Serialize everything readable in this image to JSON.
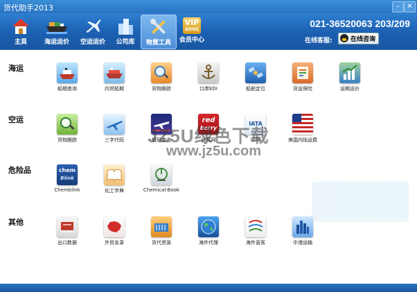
{
  "window": {
    "title": "货代助手2013"
  },
  "window_buttons": {
    "minimize": "–",
    "close": "✕"
  },
  "toolbar": {
    "items": [
      {
        "label": "主頁",
        "icon": "home-icon"
      },
      {
        "label": "海运运价",
        "icon": "ship-icon"
      },
      {
        "label": "空运运价",
        "icon": "airplane-icon"
      },
      {
        "label": "公司库",
        "icon": "buildings-icon"
      },
      {
        "label": "物貿工具",
        "icon": "tools-icon"
      },
      {
        "label": "会员中心",
        "icon": "vip-icon"
      }
    ],
    "vip_badge": "VIP",
    "vip_sub": "会员专区",
    "phone": "021-36520063  203/209",
    "online_label": "在线客服:",
    "consult_label": "在线咨询"
  },
  "sections": {
    "sea": {
      "title": "海运",
      "items": [
        {
          "label": "船期查询",
          "icon": "ship-schedule-icon"
        },
        {
          "label": "内贸船期",
          "icon": "domestic-ship-icon"
        },
        {
          "label": "货物跟踪",
          "icon": "cargo-track-icon"
        },
        {
          "label": "口岸EDI",
          "icon": "anchor-icon"
        },
        {
          "label": "船舶定位",
          "icon": "satellite-icon"
        },
        {
          "label": "货运保险",
          "icon": "insurance-icon"
        },
        {
          "label": "运期运价",
          "icon": "chart-icon"
        }
      ]
    },
    "air": {
      "title": "空运",
      "items": [
        {
          "label": "货物跟踪",
          "icon": "magnifier-icon"
        },
        {
          "label": "三字代码",
          "icon": "airplane-code-icon"
        },
        {
          "label": "航班查询",
          "icon": "flight-icon"
        },
        {
          "label": "红莓网",
          "icon": "red-berry-icon",
          "text1": "red",
          "text2": "berry"
        },
        {
          "label": "IATA",
          "icon": "iata-icon",
          "text1": "IATA"
        },
        {
          "label": "美国内陆运费",
          "icon": "us-flag-icon"
        }
      ]
    },
    "danger": {
      "title": "危险品",
      "items": [
        {
          "label": "Chemblink",
          "icon": "chemblink-icon",
          "text1": "chem",
          "text2": "Blink"
        },
        {
          "label": "化工字典",
          "icon": "dictionary-icon"
        },
        {
          "label": "Chemical-Book",
          "icon": "flask-icon"
        }
      ]
    },
    "other": {
      "title": "其他",
      "items": [
        {
          "label": "出口数据",
          "icon": "book-icon"
        },
        {
          "label": "外贸名录",
          "icon": "china-map-icon"
        },
        {
          "label": "货代资源",
          "icon": "container-icon"
        },
        {
          "label": "海外代理",
          "icon": "globe-icon"
        },
        {
          "label": "海外直客",
          "icon": "wto-icon"
        },
        {
          "label": "中港运输",
          "icon": "city-icon"
        }
      ]
    }
  },
  "watermark": {
    "line1": "JZ5U绿色下载",
    "line2": "www.jz5u.com"
  },
  "colors": {
    "toolbar": "#1c5fb0",
    "titlebar": "#2a73c2",
    "accent": "#4d8ed8"
  }
}
